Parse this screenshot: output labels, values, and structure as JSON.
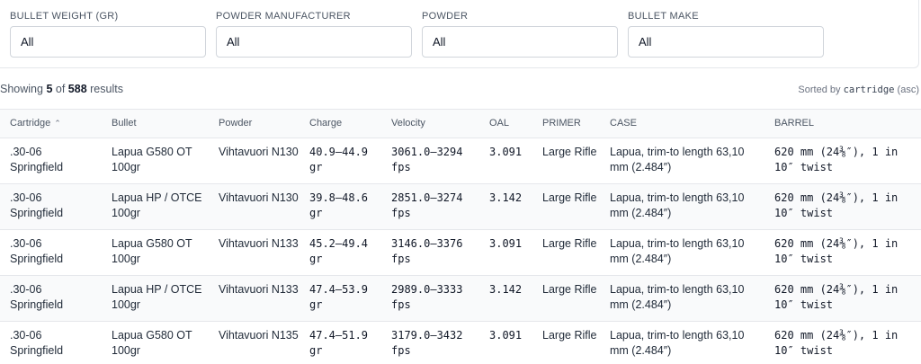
{
  "filters": [
    {
      "label": "BULLET WEIGHT (GR)",
      "value": "All"
    },
    {
      "label": "POWDER MANUFACTURER",
      "value": "All"
    },
    {
      "label": "POWDER",
      "value": "All"
    },
    {
      "label": "BULLET MAKE",
      "value": "All"
    }
  ],
  "summary": {
    "prefix": "Showing",
    "shown": "5",
    "middle": "of",
    "total": "588",
    "suffix": "results"
  },
  "sort": {
    "prefix": "Sorted by",
    "field": "cartridge",
    "direction": "(asc)"
  },
  "table": {
    "columns": [
      "Cartridge",
      "Bullet",
      "Powder",
      "Charge",
      "Velocity",
      "OAL",
      "PRIMER",
      "CASE",
      "BARREL"
    ],
    "sort_indicator": "^",
    "rows": [
      [
        ".30-06 Springfield",
        "Lapua G580 OT 100gr",
        "Vihtavuori N130",
        "40.9–44.9 gr",
        "3061.0–3294 fps",
        "3.091",
        "Large Rifle",
        "Lapua, trim-to length 63,10 mm (2.484″)",
        "620 mm (24⅜″), 1 in 10″ twist"
      ],
      [
        ".30-06 Springfield",
        "Lapua HP / OTCE 100gr",
        "Vihtavuori N130",
        "39.8–48.6 gr",
        "2851.0–3274 fps",
        "3.142",
        "Large Rifle",
        "Lapua, trim-to length 63,10 mm (2.484″)",
        "620 mm (24⅜″), 1 in 10″ twist"
      ],
      [
        ".30-06 Springfield",
        "Lapua G580 OT 100gr",
        "Vihtavuori N133",
        "45.2–49.4 gr",
        "3146.0–3376 fps",
        "3.091",
        "Large Rifle",
        "Lapua, trim-to length 63,10 mm (2.484″)",
        "620 mm (24⅜″), 1 in 10″ twist"
      ],
      [
        ".30-06 Springfield",
        "Lapua HP / OTCE 100gr",
        "Vihtavuori N133",
        "47.4–53.9 gr",
        "2989.0–3333 fps",
        "3.142",
        "Large Rifle",
        "Lapua, trim-to length 63,10 mm (2.484″)",
        "620 mm (24⅜″), 1 in 10″ twist"
      ],
      [
        ".30-06 Springfield",
        "Lapua G580 OT 100gr",
        "Vihtavuori N135",
        "47.4–51.9 gr",
        "3179.0–3432 fps",
        "3.091",
        "Large Rifle",
        "Lapua, trim-to length 63,10 mm (2.484″)",
        "620 mm (24⅜″), 1 in 10″ twist"
      ]
    ]
  }
}
